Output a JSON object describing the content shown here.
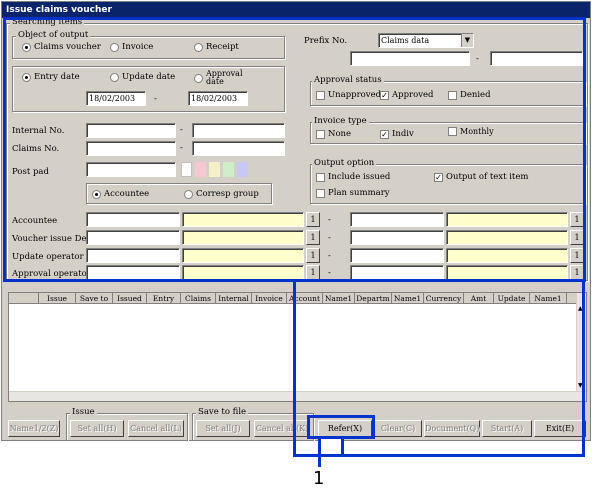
{
  "window": {
    "title": "Issue claims voucher"
  },
  "searching": {
    "label": "Searching items",
    "object_of_output": {
      "label": "Object of output",
      "options": [
        "Claims voucher",
        "Invoice",
        "Receipt"
      ],
      "selected": "Claims voucher"
    },
    "date_type": {
      "options": [
        "Entry date",
        "Update date",
        "Approval date"
      ],
      "selected": "Entry date",
      "from": "18/02/2003",
      "to": "18/02/2003",
      "separator": "-"
    },
    "internal_no": {
      "label": "Internal No.",
      "separator": "-"
    },
    "claims_no": {
      "label": "Claims No.",
      "separator": "-"
    },
    "post_pad": {
      "label": "Post pad"
    },
    "target": {
      "options": [
        "Accountee",
        "Corresp group"
      ],
      "selected": "Accountee"
    },
    "prefix": {
      "label": "Prefix No.",
      "value": "Claims data",
      "separator": "-"
    },
    "approval_status": {
      "label": "Approval status",
      "options": [
        {
          "label": "Unapproved",
          "checked": false
        },
        {
          "label": "Approved",
          "checked": true
        },
        {
          "label": "Denied",
          "checked": false
        }
      ]
    },
    "invoice_type": {
      "label": "Invoice type",
      "options": [
        {
          "label": "None",
          "checked": false
        },
        {
          "label": "Indiv",
          "checked": true
        },
        {
          "label": "Monthly",
          "checked": false
        }
      ]
    },
    "output_option": {
      "label": "Output option",
      "options": [
        {
          "label": "Include issued",
          "checked": false
        },
        {
          "label": "Output of text item",
          "checked": true
        },
        {
          "label": "Plan summary",
          "checked": false
        }
      ]
    },
    "range_rows": [
      {
        "label": "Accountee",
        "btn": "1",
        "sep": "-"
      },
      {
        "label": "Voucher issue Dept",
        "btn": "1",
        "sep": "-"
      },
      {
        "label": "Update operator",
        "btn": "1",
        "sep": "-"
      },
      {
        "label": "Approval operator",
        "btn": "1",
        "sep": "-"
      }
    ],
    "check_mark": "✓"
  },
  "table": {
    "columns": [
      "Issue",
      "Save to",
      "Issued",
      "Entry",
      "Claims",
      "Internal",
      "Invoice",
      "Account",
      "Name1",
      "Departm",
      "Name1",
      "Currency",
      "Amt",
      "Update",
      "Name1"
    ]
  },
  "bottom": {
    "name_btn": "Name1/2(Z)",
    "issue_group": {
      "label": "Issue",
      "set_all": "Set all(H)",
      "cancel_all": "Cancel all(L)"
    },
    "save_group": {
      "label": "Save to file",
      "set_all": "Set all(J)",
      "cancel_all": "Cancel all(K)"
    },
    "refer": "Refer(X)",
    "clear": "Clear(C)",
    "document": "Document(Q)",
    "start": "Start(A)",
    "exit": "Exit(E)"
  },
  "callout": {
    "number": "1"
  },
  "colors": {
    "highlight": "#0033cc",
    "title_bar": "#0a246a",
    "yellow_field": "#ffffcc"
  },
  "post_pad_swatches": [
    "#ffffff",
    "#f4c8cc",
    "#f4f0c8",
    "#cdeec8",
    "#c8c8f4"
  ]
}
